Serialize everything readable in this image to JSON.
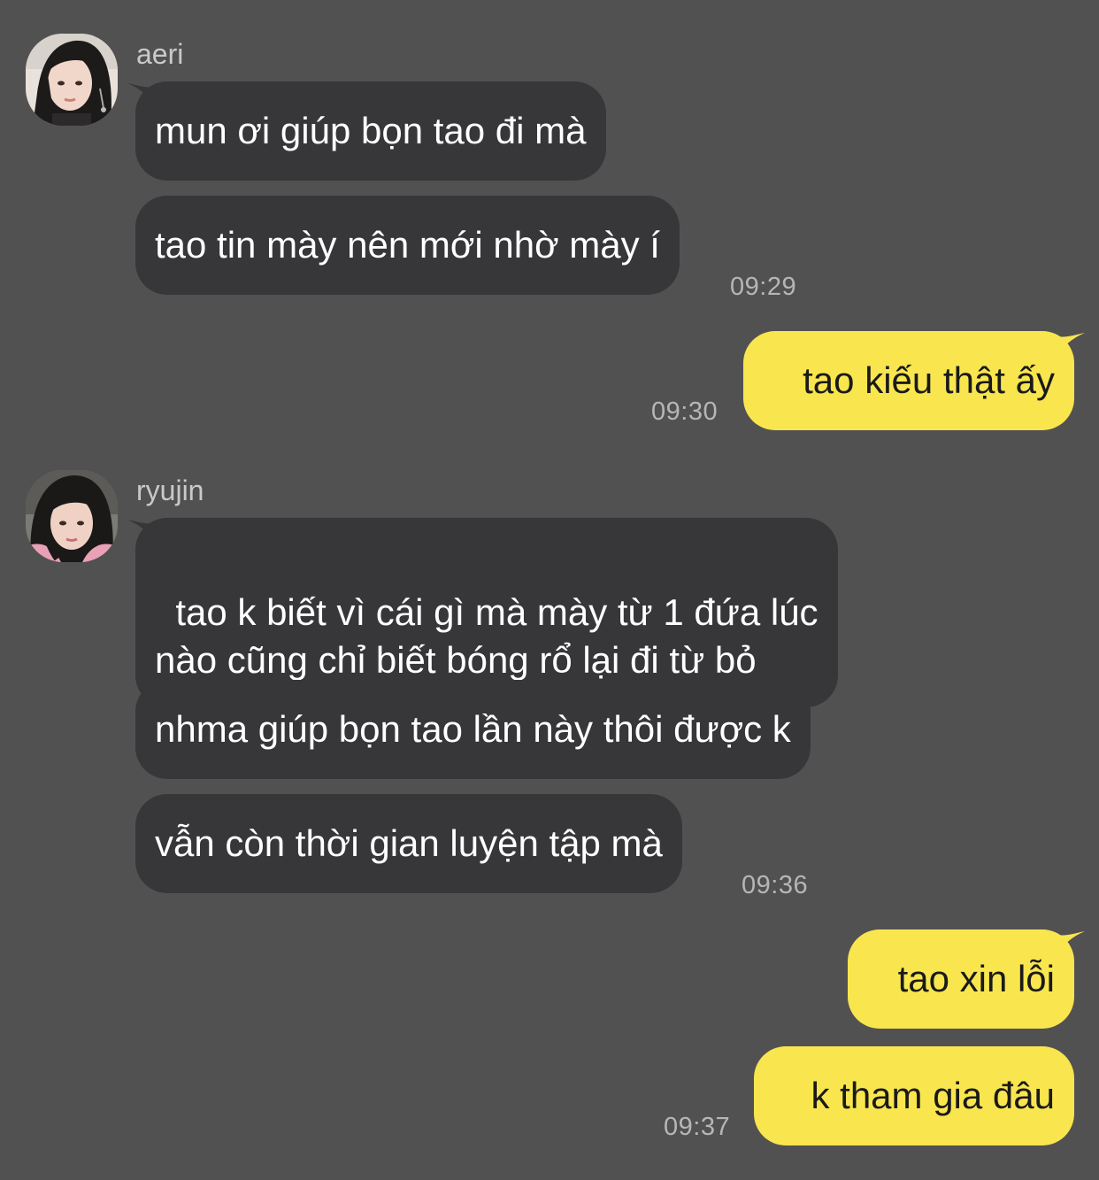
{
  "conversation": {
    "groups": [
      {
        "sender": "aeri",
        "avatar_icon": "avatar-photo-aeri",
        "messages": [
          "mun ơi giúp bọn tao đi mà",
          "tao tin mày nên mới nhờ mày í"
        ],
        "time": "09:29"
      },
      {
        "sender": "me",
        "messages": [
          "tao kiếu thật ấy"
        ],
        "time": "09:30"
      },
      {
        "sender": "ryujin",
        "avatar_icon": "avatar-photo-ryujin",
        "messages": [
          "tao k biết vì cái gì mà mày từ 1 đứa lúc\nnào cũng chỉ biết bóng rổ lại đi từ bỏ",
          "nhma giúp bọn tao lần này thôi được k",
          "vẫn còn thời gian luyện tập mà"
        ],
        "time": "09:36"
      },
      {
        "sender": "me",
        "messages": [
          "tao xin lỗi",
          "k tham gia đâu"
        ],
        "time": "09:37"
      }
    ]
  },
  "colors": {
    "background": "#525152",
    "incoming_bubble": "#373639",
    "outgoing_bubble": "#f9e64f",
    "incoming_text": "#ffffff",
    "outgoing_text": "#1a1a1a",
    "timestamp": "#b6b6b8",
    "sender_name": "#c9c9cb"
  }
}
